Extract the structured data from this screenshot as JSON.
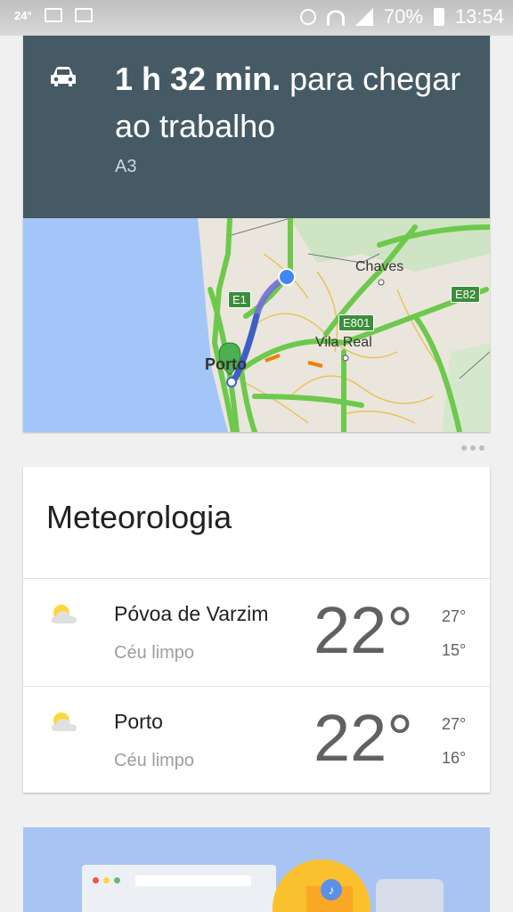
{
  "status_bar": {
    "temperature": "24°",
    "battery": "70%",
    "time": "13:54"
  },
  "commute": {
    "duration": "1 h 32 min.",
    "title_rest": " para chegar ao trabalho",
    "route": "A3",
    "map": {
      "labels": {
        "chaves": "Chaves",
        "vila_real": "Vila Real",
        "porto": "Porto",
        "e1": "E1",
        "e801": "E801",
        "e82": "E82"
      }
    }
  },
  "weather": {
    "title": "Meteorologia",
    "rows": [
      {
        "city": "Póvoa de Varzim",
        "condition": "Céu limpo",
        "temp": "22°",
        "high": "27°",
        "low": "15°"
      },
      {
        "city": "Porto",
        "condition": "Céu limpo",
        "temp": "22°",
        "high": "27°",
        "low": "16°"
      }
    ]
  },
  "colors": {
    "commute_header": "#455a64",
    "map_sea": "#a3c5f7",
    "road": "#6dc94c",
    "route": "#4a6fd1"
  },
  "icons": {
    "car": "car-icon",
    "weather": "partly-cloudy-icon"
  }
}
